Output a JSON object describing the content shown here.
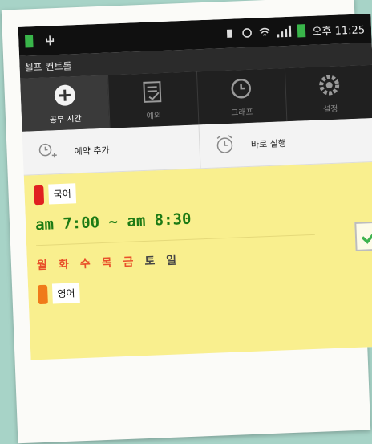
{
  "status_bar": {
    "time": "오후 11:25",
    "usb_icon": "usb-icon",
    "signal_icon": "signal-icon",
    "wifi_icon": "wifi-icon",
    "battery_color": "#39b54a"
  },
  "app": {
    "title": "셀프 컨트롤"
  },
  "tabs": [
    {
      "label": "공부 시간",
      "icon": "plus-circle-icon",
      "active": true
    },
    {
      "label": "예외",
      "icon": "checklist-icon",
      "active": false
    },
    {
      "label": "그래프",
      "icon": "clock-icon",
      "active": false
    },
    {
      "label": "설정",
      "icon": "gear-icon",
      "active": false
    }
  ],
  "actions": {
    "add_reservation": "예약 추가",
    "run_now": "바로 실행"
  },
  "schedules": [
    {
      "subject": "국어",
      "color": "#e02020",
      "time": "am 7:00  ~  am 8:30",
      "days": [
        {
          "label": "월",
          "active": true
        },
        {
          "label": "화",
          "active": true
        },
        {
          "label": "수",
          "active": true
        },
        {
          "label": "목",
          "active": true
        },
        {
          "label": "금",
          "active": true
        },
        {
          "label": "토",
          "active": false
        },
        {
          "label": "일",
          "active": false
        }
      ],
      "enabled": true
    },
    {
      "subject": "영어",
      "color": "#f07a1a"
    }
  ],
  "colors": {
    "active_day": "#e8502a",
    "inactive_day": "#444444",
    "time_text": "#1c7a14",
    "list_bg": "#f9ef8e"
  }
}
